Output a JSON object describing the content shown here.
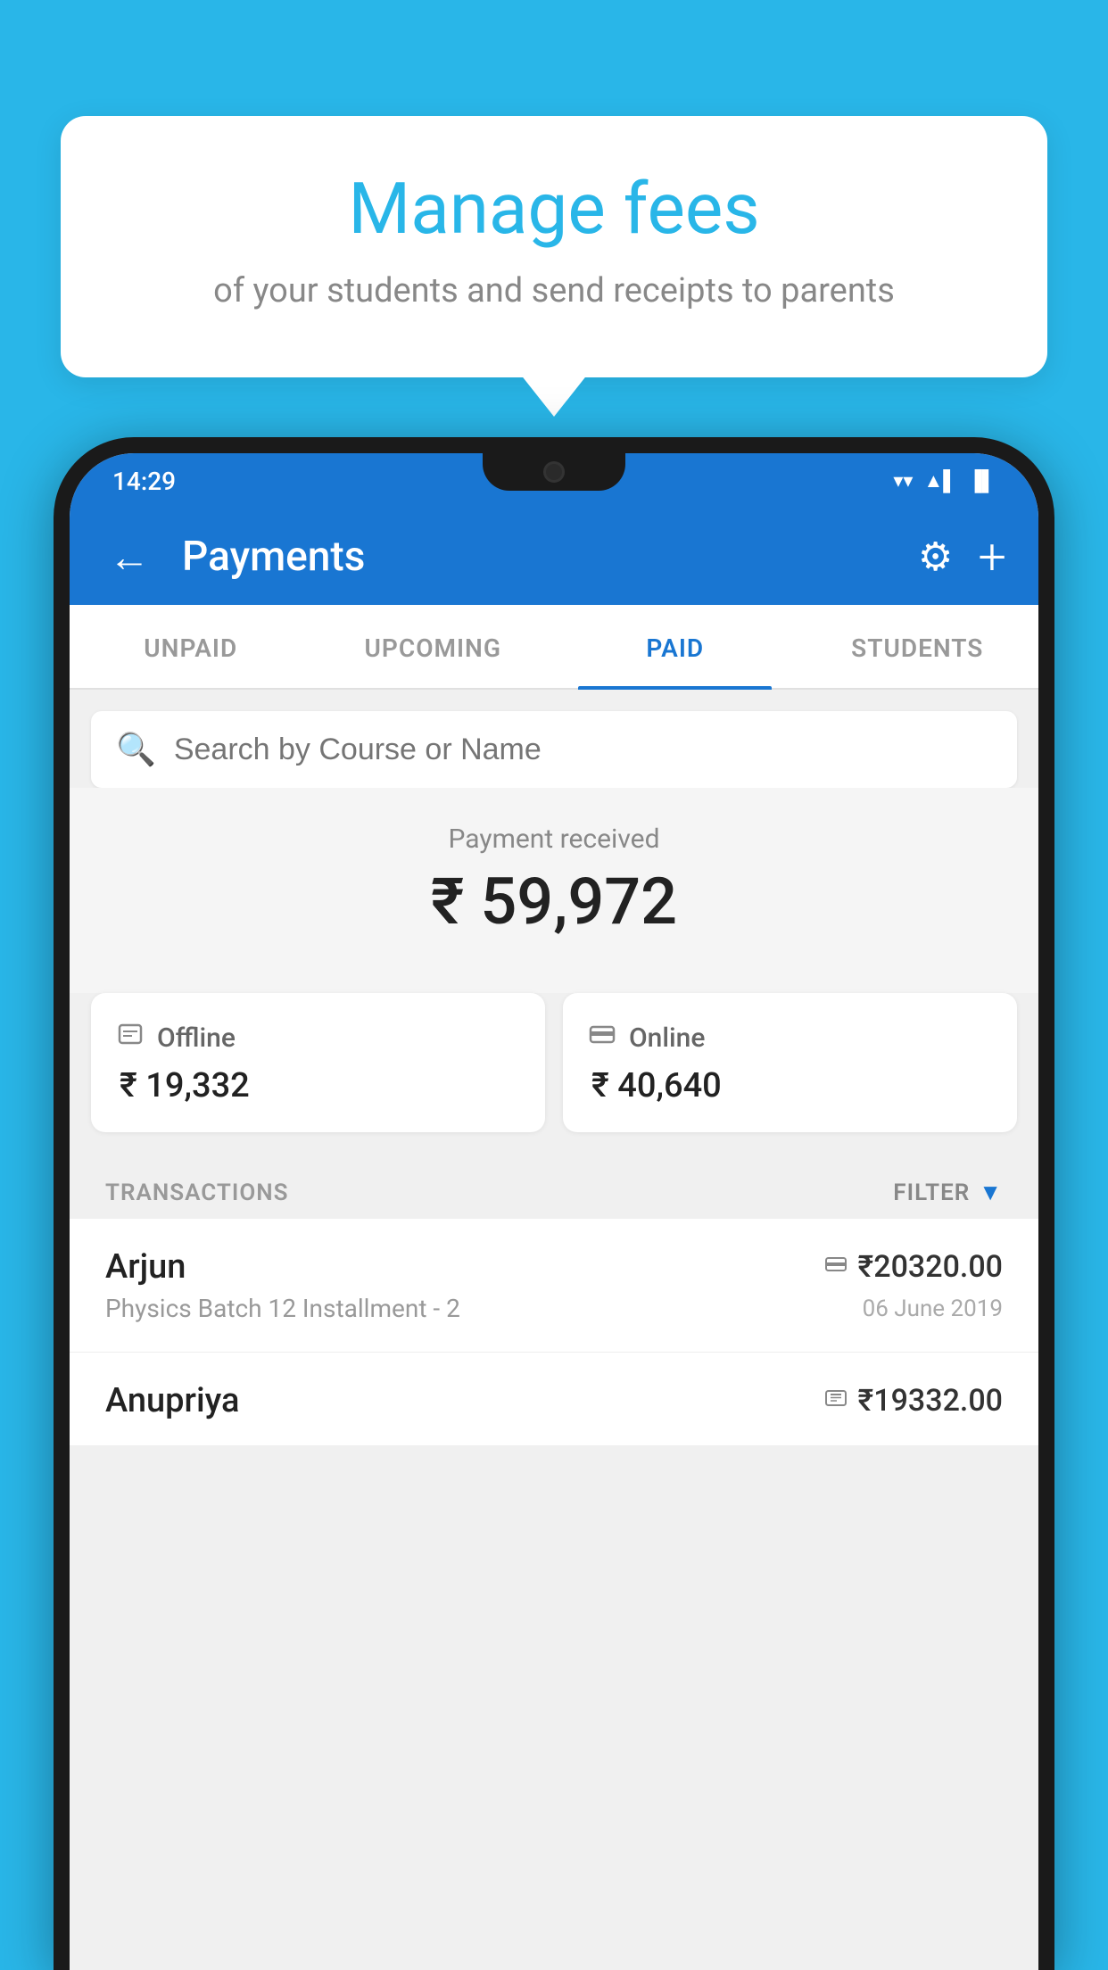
{
  "background": {
    "color": "#29b6e8"
  },
  "tooltip": {
    "title": "Manage fees",
    "subtitle": "of your students and send receipts to parents"
  },
  "status_bar": {
    "time": "14:29",
    "wifi_icon": "▼",
    "signal_icon": "▲",
    "battery_icon": "▐"
  },
  "app_bar": {
    "back_icon": "←",
    "title": "Payments",
    "settings_icon": "⚙",
    "add_icon": "+"
  },
  "tabs": [
    {
      "label": "UNPAID",
      "active": false
    },
    {
      "label": "UPCOMING",
      "active": false
    },
    {
      "label": "PAID",
      "active": true
    },
    {
      "label": "STUDENTS",
      "active": false
    }
  ],
  "search": {
    "placeholder": "Search by Course or Name",
    "icon": "🔍"
  },
  "payment_summary": {
    "label": "Payment received",
    "amount": "₹ 59,972",
    "offline": {
      "type": "Offline",
      "amount": "₹ 19,332",
      "icon": "💳"
    },
    "online": {
      "type": "Online",
      "amount": "₹ 40,640",
      "icon": "💳"
    }
  },
  "transactions": {
    "label": "TRANSACTIONS",
    "filter_label": "FILTER",
    "rows": [
      {
        "name": "Arjun",
        "course": "Physics Batch 12 Installment - 2",
        "amount": "₹20320.00",
        "date": "06 June 2019",
        "method_icon": "💳"
      },
      {
        "name": "Anupriya",
        "course": "",
        "amount": "₹19332.00",
        "date": "",
        "method_icon": "💵"
      }
    ]
  }
}
